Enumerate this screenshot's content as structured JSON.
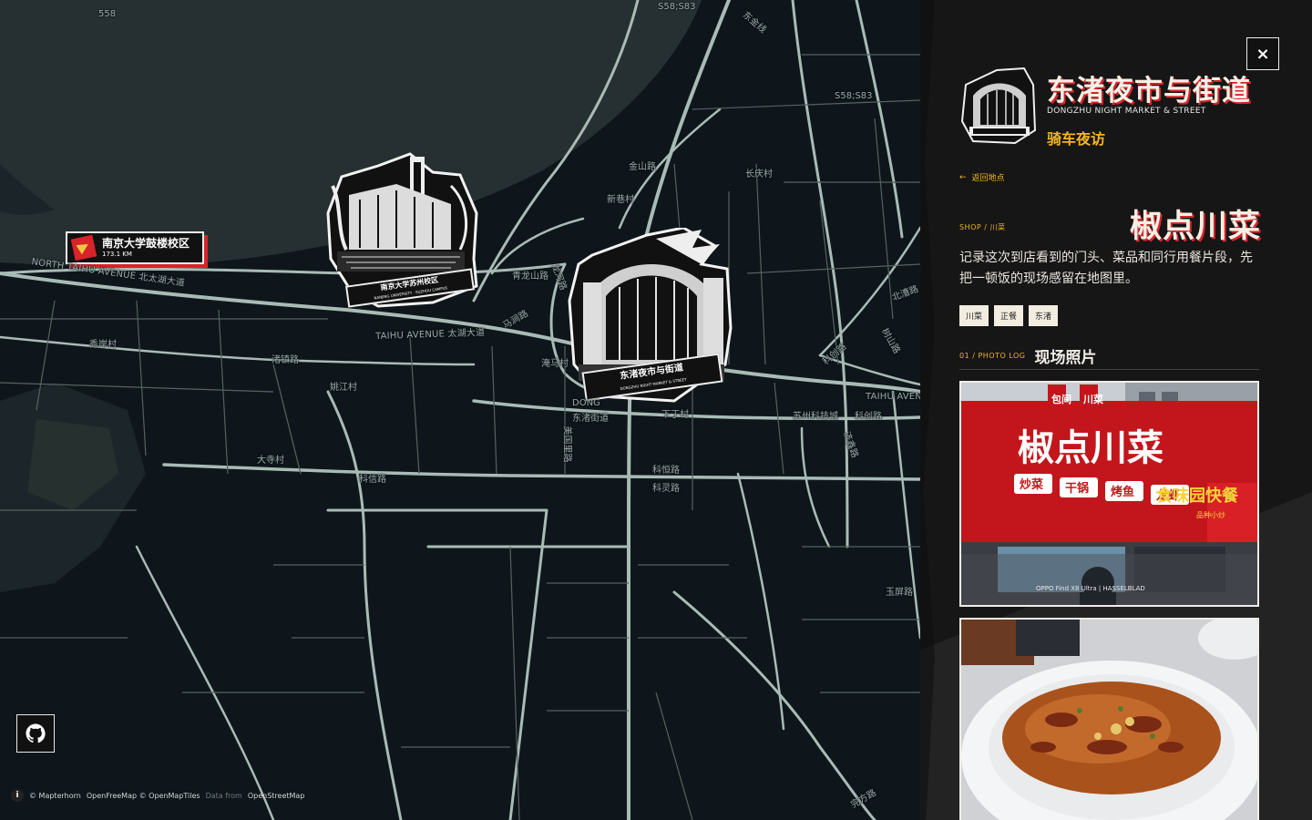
{
  "map": {
    "origin": {
      "name": "南京大学鼓楼校区",
      "distance": "173.1 KM"
    },
    "stickers": [
      {
        "label": "南京大学苏州校区",
        "sub": "NANJING UNIVERSITY · SUZHOU CAMPUS"
      },
      {
        "label": "东渚夜市与街道",
        "sub": "DONGZHU NIGHT MARKET & STREET"
      }
    ],
    "labels": {
      "l1": "558",
      "l2": "S58;S83",
      "l3": "东渚街道",
      "l4": "NORTH TAIHU AVENUE 北太湖大道",
      "l5": "TAIHU AVENUE 太湖大道",
      "l6": "渚镇路",
      "l7": "科信路",
      "l8": "科灵路",
      "l9": "科恒路",
      "l10": "大寺村",
      "l11": "姚江村",
      "l12": "秀岸村",
      "l13": "淹马村",
      "l14": "苏州科技城",
      "l15": "科创路",
      "l16": "金山路",
      "l17": "马涧路",
      "l18": "龙河路",
      "l19": "青龙山路",
      "l20": "北漕路",
      "l21": "下丁村",
      "l22": "美国里路",
      "l23": "DONG",
      "l24": "玉屏路",
      "l25": "完方路",
      "l26": "S58;S83",
      "l27": "东金线",
      "l28": "新巷村",
      "l29": "长庆村",
      "l30": "树山路",
      "l31": "TAIHU AVENUE",
      "l32": "科创路",
      "l33": "济鑫路"
    },
    "attribution": {
      "info": "i",
      "a1": "© Mapterhorn",
      "a2": "OpenFreeMap © OpenMapTiles",
      "a3": "Data from",
      "a4": "OpenStreetMap"
    }
  },
  "panel": {
    "close": "×",
    "place_title": "东渚夜市与街道",
    "place_sub": "DONGZHU NIGHT MARKET & STREET",
    "place_tag": "骑车夜访",
    "back": "返回地点",
    "back_arrow": "←",
    "kicker": "SHOP / 川菜",
    "shop_title": "椒点川菜",
    "description": "记录这次到店看到的门头、菜品和同行用餐片段，先把一顿饭的现场感留在地图里。",
    "chips": [
      "川菜",
      "正餐",
      "东渚"
    ],
    "section_num": "01 / PHOTO LOG",
    "section_title": "现场照片",
    "photo1": {
      "sign_main": "椒点川菜",
      "sign_top1": "包间",
      "sign_top2": "川菜",
      "sign_items": [
        "炒菜",
        "干锅",
        "烤鱼",
        "龙虾"
      ],
      "sign_right": "食味园快餐",
      "sign_right_sub": "品种小炒",
      "watermark": "OPPO Find X8 Ultra | HASSELBLAD"
    }
  }
}
